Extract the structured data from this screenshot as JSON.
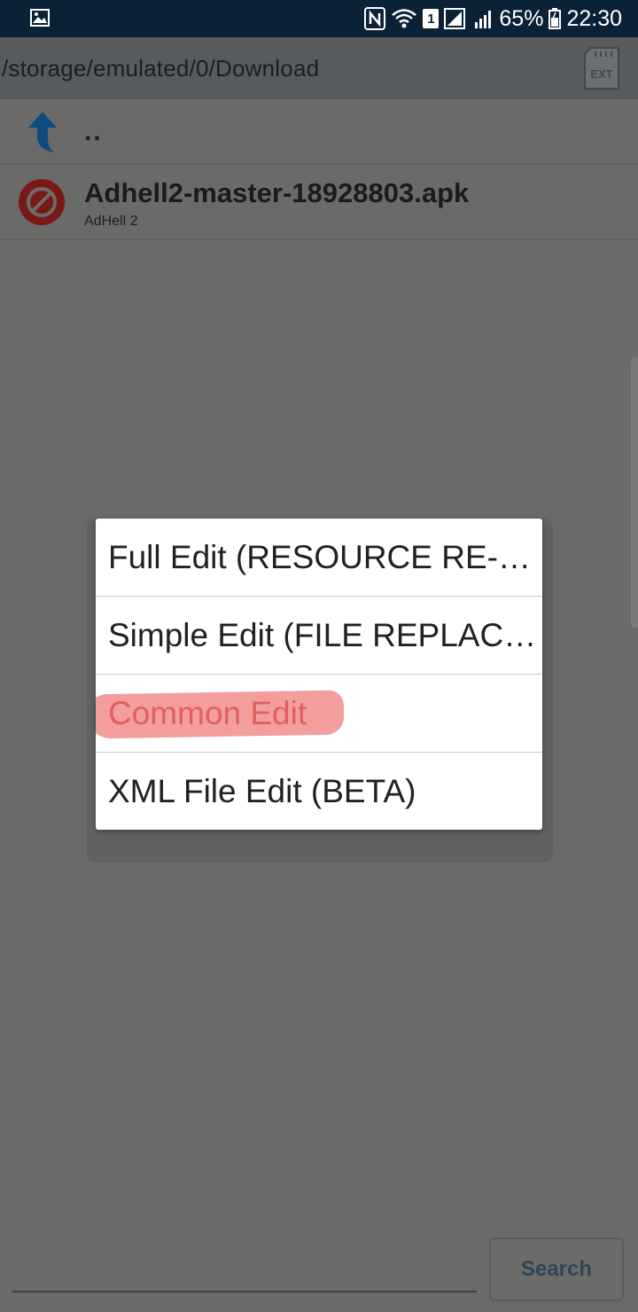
{
  "status_bar": {
    "battery": "65%",
    "time": "22:30",
    "sim": "1",
    "icons": [
      "gallery-icon",
      "nfc-icon",
      "wifi-icon",
      "sim-icon",
      "signal-icon",
      "battery-icon"
    ]
  },
  "path_bar": {
    "path": "/storage/emulated/0/Download",
    "ext_label": "EXT"
  },
  "file_list": {
    "parent_label": "..",
    "items": [
      {
        "name": "Adhell2-master-18928803.apk",
        "subtitle": "AdHell 2",
        "icon": "blocked-icon"
      }
    ]
  },
  "dialog": {
    "items": [
      {
        "label": "Full Edit (RESOURCE RE-BUILD)"
      },
      {
        "label": "Simple Edit (FILE REPLACEMENT)"
      },
      {
        "label": "Common Edit"
      },
      {
        "label": "XML File Edit (BETA)"
      }
    ]
  },
  "search": {
    "button_label": "Search"
  },
  "colors": {
    "highlight": "#f28c8c",
    "status_bar": "#0b2236",
    "search_text": "#2f4456"
  }
}
